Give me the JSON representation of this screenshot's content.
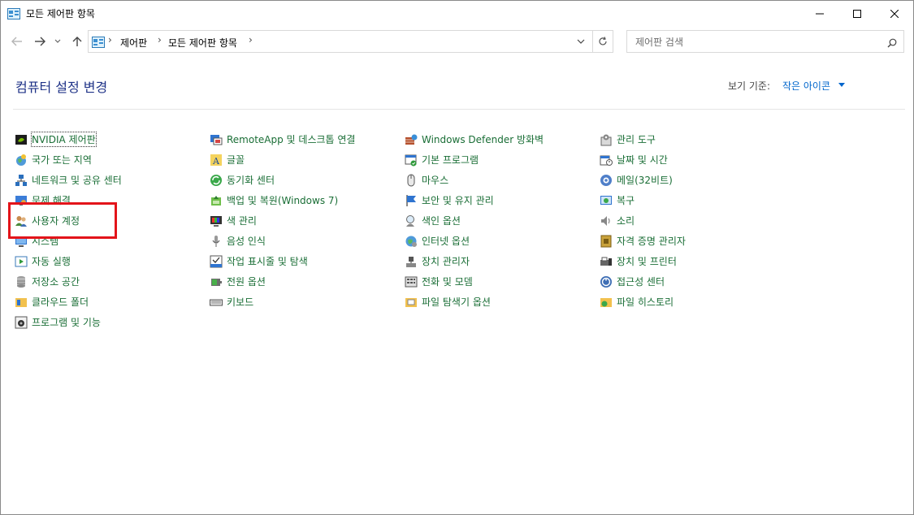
{
  "window": {
    "title": "모든 제어판 항목",
    "controls": [
      "minimize",
      "maximize",
      "close"
    ]
  },
  "nav": {
    "breadcrumb": [
      "제어판",
      "모든 제어판 항목"
    ],
    "search_placeholder": "제어판 검색"
  },
  "header": {
    "title": "컴퓨터 설정 변경",
    "view_by_label": "보기 기준:",
    "view_by_value": "작은 아이콘"
  },
  "columns": [
    [
      {
        "label": "NVIDIA 제어판",
        "icon": "nvidia-icon"
      },
      {
        "label": "국가 또는 지역",
        "icon": "region-icon"
      },
      {
        "label": "네트워크 및 공유 센터",
        "icon": "network-icon"
      },
      {
        "label": "문제 해결",
        "icon": "troubleshoot-icon"
      },
      {
        "label": "사용자 계정",
        "icon": "user-accounts-icon"
      },
      {
        "label": "시스템",
        "icon": "system-icon"
      },
      {
        "label": "자동 실행",
        "icon": "autoplay-icon"
      },
      {
        "label": "저장소 공간",
        "icon": "storage-icon"
      },
      {
        "label": "클라우드 폴더",
        "icon": "work-folders-icon"
      },
      {
        "label": "프로그램 및 기능",
        "icon": "programs-icon"
      }
    ],
    [
      {
        "label": "RemoteApp 및 데스크톱 연결",
        "icon": "remoteapp-icon"
      },
      {
        "label": "글꼴",
        "icon": "fonts-icon"
      },
      {
        "label": "동기화 센터",
        "icon": "sync-icon"
      },
      {
        "label": "백업 및 복원(Windows 7)",
        "icon": "backup-icon"
      },
      {
        "label": "색 관리",
        "icon": "color-management-icon"
      },
      {
        "label": "음성 인식",
        "icon": "speech-icon"
      },
      {
        "label": "작업 표시줄 및 탐색",
        "icon": "taskbar-icon"
      },
      {
        "label": "전원 옵션",
        "icon": "power-icon"
      },
      {
        "label": "키보드",
        "icon": "keyboard-icon"
      }
    ],
    [
      {
        "label": "Windows Defender 방화벽",
        "icon": "firewall-icon"
      },
      {
        "label": "기본 프로그램",
        "icon": "default-programs-icon"
      },
      {
        "label": "마우스",
        "icon": "mouse-icon"
      },
      {
        "label": "보안 및 유지 관리",
        "icon": "security-flag-icon"
      },
      {
        "label": "색인 옵션",
        "icon": "indexing-icon"
      },
      {
        "label": "인터넷 옵션",
        "icon": "internet-options-icon"
      },
      {
        "label": "장치 관리자",
        "icon": "device-manager-icon"
      },
      {
        "label": "전화 및 모뎀",
        "icon": "phone-modem-icon"
      },
      {
        "label": "파일 탐색기 옵션",
        "icon": "folder-options-icon"
      }
    ],
    [
      {
        "label": "관리 도구",
        "icon": "admin-tools-icon"
      },
      {
        "label": "날짜 및 시간",
        "icon": "datetime-icon"
      },
      {
        "label": "메일(32비트)",
        "icon": "mail-icon"
      },
      {
        "label": "복구",
        "icon": "recovery-icon"
      },
      {
        "label": "소리",
        "icon": "sound-icon"
      },
      {
        "label": "자격 증명 관리자",
        "icon": "credential-icon"
      },
      {
        "label": "장치 및 프린터",
        "icon": "devices-printers-icon"
      },
      {
        "label": "접근성 센터",
        "icon": "ease-of-access-icon"
      },
      {
        "label": "파일 히스토리",
        "icon": "file-history-icon"
      }
    ]
  ],
  "colors": {
    "link": "#1a6e36",
    "title": "#1e3287",
    "accent": "#0066cc",
    "highlight": "#e3141a"
  }
}
